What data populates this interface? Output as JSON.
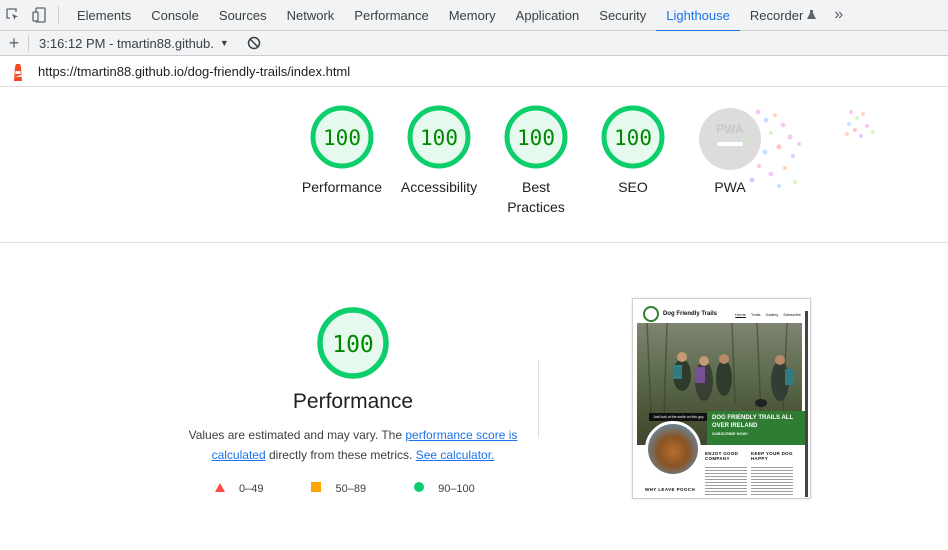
{
  "devtools": {
    "tabs": [
      "Elements",
      "Console",
      "Sources",
      "Network",
      "Performance",
      "Memory",
      "Application",
      "Security",
      "Lighthouse",
      "Recorder"
    ],
    "active_tab": "Lighthouse",
    "more_symbol": "»"
  },
  "report_bar": {
    "report_label": "3:16:12 PM - tmartin88.github."
  },
  "url_bar": {
    "url": "https://tmartin88.github.io/dog-friendly-trails/index.html"
  },
  "gauges": [
    {
      "score": "100",
      "label": "Performance"
    },
    {
      "score": "100",
      "label": "Accessibility"
    },
    {
      "score": "100",
      "label": "Best Practices"
    },
    {
      "score": "100",
      "label": "SEO"
    },
    {
      "score": "PWA",
      "label": "PWA"
    }
  ],
  "performance": {
    "score": "100",
    "title": "Performance",
    "desc_prefix": "Values are estimated and may vary. The ",
    "link_score": "performance score is calculated",
    "desc_middle": " directly from these metrics. ",
    "link_calc": "See calculator.",
    "legend": [
      {
        "range": "0–49"
      },
      {
        "range": "50–89"
      },
      {
        "range": "90–100"
      }
    ]
  },
  "thumbnail": {
    "brand": "Dog Friendly Trails",
    "links": [
      "Home",
      "Trails",
      "Gallery",
      "Subscribe"
    ],
    "look_tag": "Just look at the smile on this guy",
    "banner_title": "DOG FRIENDLY TRAILS ALL OVER IRELAND",
    "banner_sub": "SUBSCRIBE NOW!",
    "col1": "ENJOY GOOD COMPANY",
    "col2": "KEEP YOUR DOG HAPPY",
    "why": "WHY LEAVE POOCH"
  },
  "colors": {
    "pass": "#0cce6b",
    "pass_text": "#008800",
    "pass_fill": "#e5f9ee",
    "average": "#ffa400",
    "fail": "#ff4e42",
    "accent": "#1a73e8"
  }
}
